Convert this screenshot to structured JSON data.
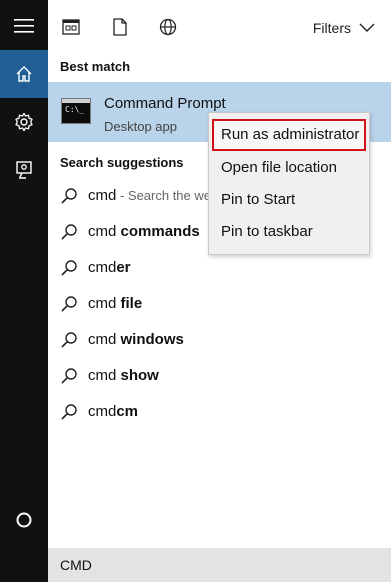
{
  "toolbar": {
    "filters_label": "Filters"
  },
  "rail": {
    "items": [
      {
        "icon": "hamburger-menu-icon"
      },
      {
        "icon": "home-icon"
      },
      {
        "icon": "settings-gear-icon"
      },
      {
        "icon": "feedback-icon"
      },
      {
        "icon": "cortana-circle-icon"
      }
    ]
  },
  "best_match": {
    "section_label": "Best match",
    "title": "Command Prompt",
    "subtitle": "Desktop app",
    "icon_prompt": "C:\\_"
  },
  "suggestions": {
    "section_label": "Search suggestions",
    "items": [
      {
        "prefix": "cmd",
        "bold": "",
        "hint": " - Search the we"
      },
      {
        "prefix": "cmd ",
        "bold": "commands",
        "hint": ""
      },
      {
        "prefix": "cmd",
        "bold": "er",
        "hint": ""
      },
      {
        "prefix": "cmd ",
        "bold": "file",
        "hint": ""
      },
      {
        "prefix": "cmd ",
        "bold": "windows",
        "hint": ""
      },
      {
        "prefix": "cmd ",
        "bold": "show",
        "hint": ""
      },
      {
        "prefix": "cmd",
        "bold": "cm",
        "hint": ""
      }
    ]
  },
  "context_menu": {
    "items": [
      {
        "label": "Run as administrator",
        "highlighted": true
      },
      {
        "label": "Open file location",
        "highlighted": false
      },
      {
        "label": "Pin to Start",
        "highlighted": false
      },
      {
        "label": "Pin to taskbar",
        "highlighted": false
      }
    ]
  },
  "search_box": {
    "query": "CMD"
  },
  "colors": {
    "rail_bg": "#111111",
    "rail_active": "#1f5f94",
    "best_match_bg": "#b9d3ea",
    "highlight_border": "#d01218"
  }
}
